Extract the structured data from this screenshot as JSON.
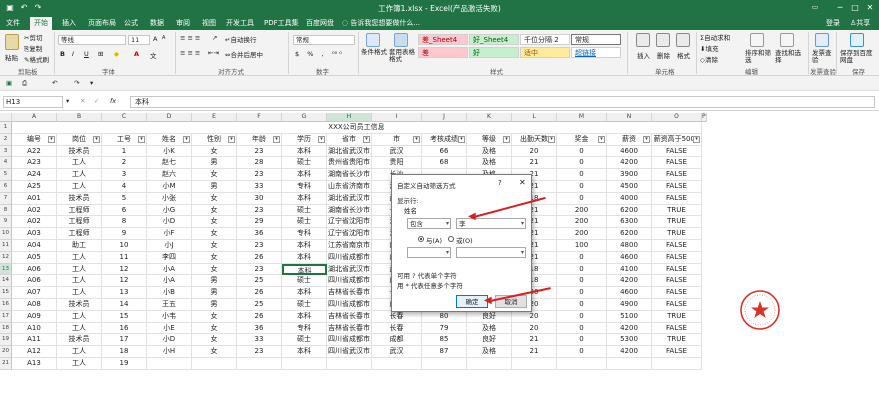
{
  "titlebar": {
    "title": "工作簿1.xlsx - Excel(产品激活失败)",
    "login": "登录",
    "share": "共享"
  },
  "tabs": [
    "文件",
    "开始",
    "插入",
    "页面布局",
    "公式",
    "数据",
    "审阅",
    "视图",
    "开发工具",
    "PDF工具集",
    "百度网盘"
  ],
  "active_tab": "开始",
  "tell_me": "告诉我您想要做什么...",
  "ribbon": {
    "clipboard": {
      "paste": "粘贴",
      "cut": "剪切",
      "copy": "复制",
      "format_painter": "格式刷",
      "label": "剪贴板"
    },
    "font": {
      "name": "等线",
      "size": "11",
      "label": "字体",
      "bold": "B",
      "italic": "I",
      "underline": "U"
    },
    "alignment": {
      "wrap": "自动换行",
      "merge": "合并后居中",
      "label": "对齐方式"
    },
    "number": {
      "format": "常规",
      "label": "数字"
    },
    "styles": {
      "conditional": "条件格式",
      "table": "套用表格格式",
      "cell_styles": "单元格样式",
      "label": "样式",
      "cells": [
        "差_Sheet4",
        "好_Sheet4",
        "千位分隔 2",
        "常规",
        "差",
        "好",
        "适中",
        "超链接"
      ]
    },
    "cells_group": {
      "insert": "插入",
      "delete": "删除",
      "format": "格式",
      "label": "单元格"
    },
    "editing": {
      "autosum": "自动求和",
      "fill": "填充",
      "clear": "清除",
      "sort": "排序和筛选",
      "find": "查找和选择",
      "label": "编辑"
    },
    "invoice": {
      "check": "发票查验",
      "label": "发票查验"
    },
    "save": {
      "label": "保存到百度网盘",
      "group": "保存"
    }
  },
  "formula_bar": {
    "cell": "H13",
    "fx": "fx",
    "value": "本科"
  },
  "columns": [
    "A",
    "B",
    "C",
    "D",
    "E",
    "F",
    "G",
    "H",
    "I",
    "J",
    "K",
    "L",
    "M",
    "N",
    "O",
    "P"
  ],
  "sheet_title": "XXX公司员工信息",
  "headers": [
    "编号",
    "岗位",
    "工号",
    "姓名",
    "性别",
    "年龄",
    "学历",
    "省市",
    "市",
    "考核成绩",
    "等级",
    "出勤天数",
    "奖金",
    "薪资",
    "薪资高于5000"
  ],
  "rows": [
    [
      "A22",
      "技术员",
      "1",
      "小K",
      "女",
      "23",
      "本科",
      "湖北省武汉市",
      "武汉",
      "66",
      "及格",
      "20",
      "0",
      "4600",
      "FALSE"
    ],
    [
      "A23",
      "工人",
      "2",
      "赵七",
      "男",
      "28",
      "硕士",
      "贵州省贵阳市",
      "贵阳",
      "68",
      "及格",
      "21",
      "0",
      "4200",
      "FALSE"
    ],
    [
      "A24",
      "工人",
      "3",
      "赵六",
      "女",
      "23",
      "本科",
      "湖南省长沙市",
      "长沙",
      "",
      "及格",
      "21",
      "0",
      "3900",
      "FALSE"
    ],
    [
      "A25",
      "工人",
      "4",
      "小M",
      "男",
      "33",
      "专科",
      "山东省济南市",
      "济南",
      "",
      "及格",
      "21",
      "0",
      "4500",
      "FALSE"
    ],
    [
      "A01",
      "技术员",
      "5",
      "小张",
      "女",
      "30",
      "本科",
      "湖北省武汉市",
      "武汉",
      "",
      "不及格",
      "18",
      "0",
      "4000",
      "FALSE"
    ],
    [
      "A02",
      "工程师",
      "6",
      "小G",
      "女",
      "23",
      "硕士",
      "湖南省长沙市",
      "长沙",
      "",
      "优秀",
      "21",
      "200",
      "6200",
      "TRUE"
    ],
    [
      "A02",
      "工程师",
      "8",
      "小D",
      "女",
      "29",
      "硕士",
      "辽宁省沈阳市",
      "沈阳",
      "",
      "优秀",
      "21",
      "200",
      "6300",
      "TRUE"
    ],
    [
      "A03",
      "工程师",
      "9",
      "小F",
      "女",
      "36",
      "专科",
      "辽宁省沈阳市",
      "沈阳",
      "",
      "优秀",
      "21",
      "200",
      "6200",
      "TRUE"
    ],
    [
      "A04",
      "助工",
      "10",
      "小J",
      "女",
      "23",
      "本科",
      "江苏省南京市",
      "南京",
      "",
      "良好",
      "21",
      "100",
      "4800",
      "FALSE"
    ],
    [
      "A05",
      "工人",
      "11",
      "李四",
      "女",
      "26",
      "本科",
      "四川省成都市",
      "成都",
      "",
      "不及格",
      "21",
      "0",
      "4600",
      "FALSE"
    ],
    [
      "A06",
      "工人",
      "12",
      "小A",
      "女",
      "23",
      "本科",
      "湖北省武汉市",
      "武汉",
      "",
      "不及格",
      "18",
      "0",
      "4100",
      "FALSE"
    ],
    [
      "A06",
      "工人",
      "12",
      "小A",
      "男",
      "25",
      "硕士",
      "四川省成都市",
      "成都",
      "",
      "不及格",
      "18",
      "0",
      "4200",
      "FALSE"
    ],
    [
      "A07",
      "工人",
      "13",
      "小B",
      "男",
      "26",
      "本科",
      "吉林省长春市",
      "长春",
      "65",
      "及格",
      "20",
      "0",
      "4600",
      "FALSE"
    ],
    [
      "A08",
      "技术员",
      "14",
      "王五",
      "男",
      "25",
      "硕士",
      "四川省成都市",
      "成都",
      "",
      "及格",
      "20",
      "0",
      "4900",
      "FALSE"
    ],
    [
      "A09",
      "工人",
      "15",
      "小韦",
      "女",
      "26",
      "本科",
      "吉林省长春市",
      "长春",
      "80",
      "良好",
      "20",
      "0",
      "5100",
      "TRUE"
    ],
    [
      "A10",
      "工人",
      "16",
      "小E",
      "女",
      "36",
      "专科",
      "吉林省长春市",
      "长春",
      "79",
      "及格",
      "20",
      "0",
      "4200",
      "FALSE"
    ],
    [
      "A11",
      "技术员",
      "17",
      "小D",
      "女",
      "33",
      "硕士",
      "四川省成都市",
      "成都",
      "85",
      "良好",
      "21",
      "0",
      "5300",
      "TRUE"
    ],
    [
      "A12",
      "工人",
      "18",
      "小H",
      "女",
      "23",
      "本科",
      "四川省武汉市",
      "武汉",
      "87",
      "及格",
      "21",
      "0",
      "4200",
      "FALSE"
    ],
    [
      "A13",
      "工人",
      "19",
      "",
      "",
      "",
      "",
      "",
      "",
      "",
      "",
      "",
      "",
      "",
      ""
    ]
  ],
  "dialog": {
    "title": "自定义自动筛选方式",
    "help": "?",
    "close": "✕",
    "show_rows": "显示行:",
    "field": "姓名",
    "op1": "包含",
    "val1": "李",
    "and_label": "与(A)",
    "or_label": "或(O)",
    "hint1": "可用 ? 代表单个字符",
    "hint2": "用 * 代表任意多个字符",
    "ok": "确定",
    "cancel": "取消"
  },
  "colors": {
    "excel_green": "#217346",
    "arrow_red": "#d62020",
    "seal_red": "#d8332b"
  }
}
